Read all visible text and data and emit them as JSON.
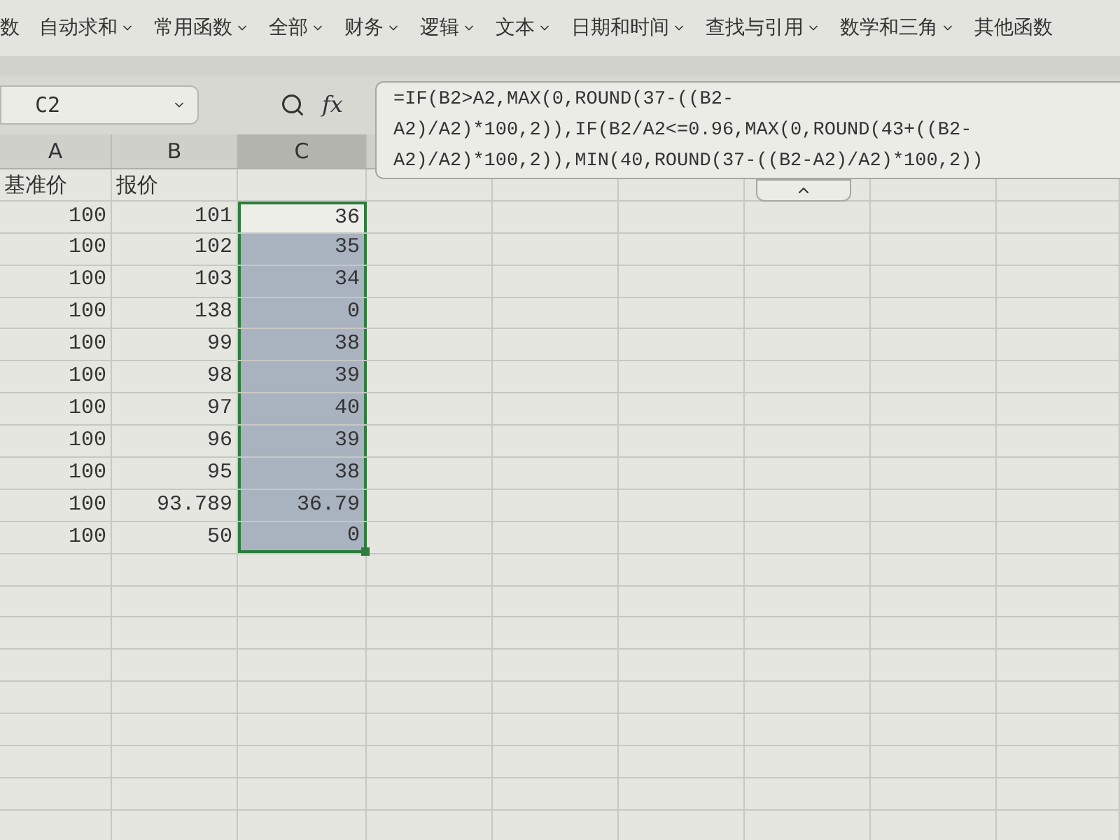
{
  "ribbon": [
    {
      "label": "数",
      "dropdown": false
    },
    {
      "label": "自动求和",
      "dropdown": true
    },
    {
      "label": "常用函数",
      "dropdown": true
    },
    {
      "label": "全部",
      "dropdown": true
    },
    {
      "label": "财务",
      "dropdown": true
    },
    {
      "label": "逻辑",
      "dropdown": true
    },
    {
      "label": "文本",
      "dropdown": true
    },
    {
      "label": "日期和时间",
      "dropdown": true
    },
    {
      "label": "查找与引用",
      "dropdown": true
    },
    {
      "label": "数学和三角",
      "dropdown": true
    },
    {
      "label": "其他函数",
      "dropdown": false
    }
  ],
  "name_box": {
    "value": "C2"
  },
  "formula_bar": {
    "label": "fx",
    "value": "=IF(B2>A2,MAX(0,ROUND(37-((B2-A2)/A2)*100,2)),IF(B2/A2<=0.96,MAX(0,ROUND(43+((B2-A2)/A2)*100,2)),MIN(40,ROUND(37-((B2-A2)/A2)*100,2))"
  },
  "columns": [
    {
      "label": "A",
      "selected": false
    },
    {
      "label": "B",
      "selected": false
    },
    {
      "label": "C",
      "selected": true
    }
  ],
  "rows": [
    {
      "cells": [
        {
          "text": "基准价",
          "selected": false
        },
        {
          "text": "报价",
          "selected": false
        }
      ]
    },
    {
      "cells": [
        {
          "text": "100",
          "selected": false
        },
        {
          "text": "101",
          "selected": false
        },
        {
          "text": "36",
          "selected": true,
          "active": true
        }
      ]
    },
    {
      "cells": [
        {
          "text": "100",
          "selected": false
        },
        {
          "text": "102",
          "selected": false
        },
        {
          "text": "35",
          "selected": true,
          "active": false
        }
      ]
    },
    {
      "cells": [
        {
          "text": "100",
          "selected": false
        },
        {
          "text": "103",
          "selected": false
        },
        {
          "text": "34",
          "selected": true,
          "active": false
        }
      ]
    },
    {
      "cells": [
        {
          "text": "100",
          "selected": false
        },
        {
          "text": "138",
          "selected": false
        },
        {
          "text": "0",
          "selected": true,
          "active": false
        }
      ]
    },
    {
      "cells": [
        {
          "text": "100",
          "selected": false
        },
        {
          "text": "99",
          "selected": false
        },
        {
          "text": "38",
          "selected": true,
          "active": false
        }
      ]
    },
    {
      "cells": [
        {
          "text": "100",
          "selected": false
        },
        {
          "text": "98",
          "selected": false
        },
        {
          "text": "39",
          "selected": true,
          "active": false
        }
      ]
    },
    {
      "cells": [
        {
          "text": "100",
          "selected": false
        },
        {
          "text": "97",
          "selected": false
        },
        {
          "text": "40",
          "selected": true,
          "active": false
        }
      ]
    },
    {
      "cells": [
        {
          "text": "100",
          "selected": false
        },
        {
          "text": "96",
          "selected": false
        },
        {
          "text": "39",
          "selected": true,
          "active": false
        }
      ]
    },
    {
      "cells": [
        {
          "text": "100",
          "selected": false
        },
        {
          "text": "95",
          "selected": false
        },
        {
          "text": "38",
          "selected": true,
          "active": false
        }
      ]
    },
    {
      "cells": [
        {
          "text": "100",
          "selected": false
        },
        {
          "text": "93.789",
          "selected": false
        },
        {
          "text": "36.79",
          "selected": true,
          "active": false
        }
      ]
    },
    {
      "cells": [
        {
          "text": "100",
          "selected": false
        },
        {
          "text": "50",
          "selected": false
        },
        {
          "text": "0",
          "selected": true,
          "active": false
        }
      ]
    }
  ]
}
